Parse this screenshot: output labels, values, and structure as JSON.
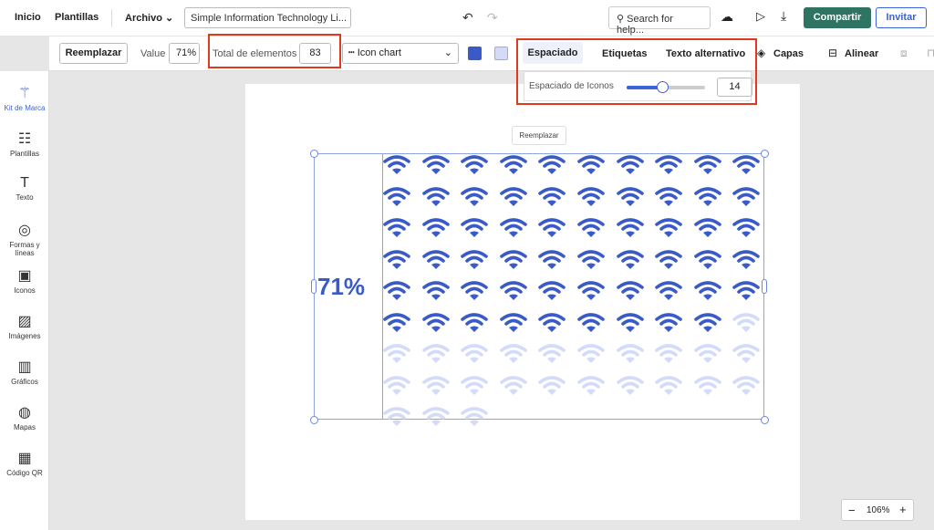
{
  "topbar": {
    "home": "Inicio",
    "templates": "Plantillas",
    "file": "Archivo",
    "doc_title": "Simple Information Technology Li...",
    "search_placeholder": "Search for help...",
    "share": "Compartir",
    "invite": "Invitar"
  },
  "toolbar": {
    "replace": "Reemplazar",
    "value_label": "Value",
    "value": "71%",
    "total_label": "Total de elementos",
    "total": "83",
    "chart_type": "Icon chart",
    "fill_color": "#3a5bc7",
    "empty_color": "#d3dbf8",
    "tabs": [
      "Espaciado",
      "Etiquetas",
      "Texto alternativo"
    ],
    "active_tab": "Espaciado",
    "layers": "Capas",
    "align": "Alinear"
  },
  "spacing_panel": {
    "label": "Espaciado de Iconos",
    "value": "14",
    "slider_fraction": 0.45
  },
  "sidebar": [
    {
      "label": "Kit de Marca",
      "icon": "magic-wand-icon"
    },
    {
      "label": "Plantillas",
      "icon": "templates-icon"
    },
    {
      "label": "Texto",
      "icon": "text-icon"
    },
    {
      "label": "Formas y líneas",
      "icon": "shapes-icon"
    },
    {
      "label": "Iconos",
      "icon": "briefcase-icon"
    },
    {
      "label": "Imágenes",
      "icon": "image-icon"
    },
    {
      "label": "Gráficos",
      "icon": "bar-chart-icon"
    },
    {
      "label": "Mapas",
      "icon": "globe-icon"
    },
    {
      "label": "Código QR",
      "icon": "qr-icon"
    }
  ],
  "canvas": {
    "tooltip": "Reemplazar",
    "percent_label": "71%",
    "icon": "wifi-icon",
    "total": 83,
    "filled": 59,
    "columns": 10
  },
  "zoom": {
    "value": "106%",
    "minus": "−",
    "plus": "+"
  }
}
